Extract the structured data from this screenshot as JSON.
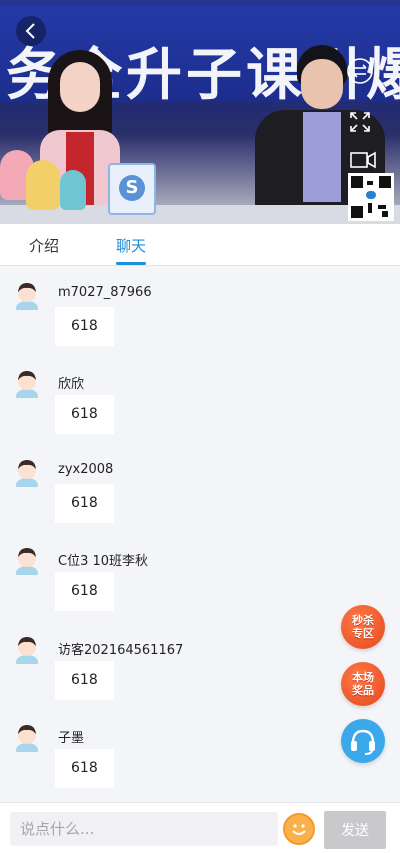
{
  "video": {
    "banner_text": "务全升子课引爆"
  },
  "tabs": [
    {
      "label": "介绍",
      "active": false
    },
    {
      "label": "聊天",
      "active": true
    }
  ],
  "chat": {
    "messages": [
      {
        "user": "m7027_87966",
        "text": "618"
      },
      {
        "user": "欣欣",
        "text": "618"
      },
      {
        "user": "zyx2008",
        "text": "618"
      },
      {
        "user": "C位3 10班李秋",
        "text": "618"
      },
      {
        "user": "访客202164561167",
        "text": "618"
      },
      {
        "user": "子墨",
        "text": "618"
      }
    ]
  },
  "floating": {
    "flash_sale": {
      "line1": "秒杀",
      "line2": "专区"
    },
    "prizes": {
      "line1": "本场",
      "line2": "奖品"
    }
  },
  "input": {
    "placeholder": "说点什么...",
    "send_label": "发送"
  },
  "colors": {
    "accent": "#1c8fd8",
    "float_red": "#e6471c",
    "float_blue": "#3ba8ec"
  }
}
